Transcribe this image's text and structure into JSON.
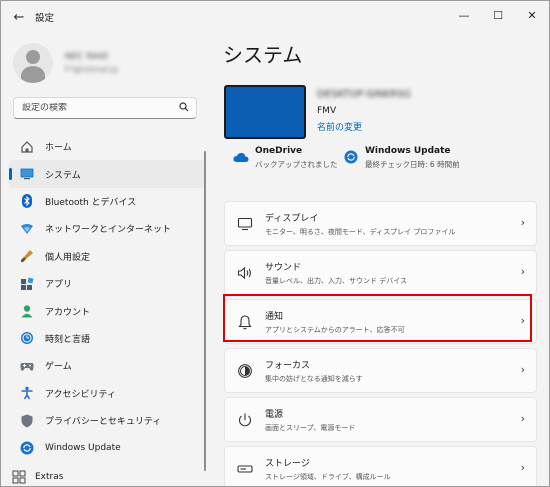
{
  "window": {
    "title": "設定",
    "back_glyph": "←",
    "minimize_glyph": "—",
    "maximize_glyph": "☐",
    "close_glyph": "✕"
  },
  "profile": {
    "name": "NEC RAID",
    "email": "F*@hotmail.jp"
  },
  "search": {
    "placeholder": "設定の検索",
    "icon": "search-icon"
  },
  "nav": {
    "items": [
      {
        "label": "ホーム",
        "icon": "home-icon"
      },
      {
        "label": "システム",
        "icon": "system-icon",
        "active": true
      },
      {
        "label": "Bluetooth とデバイス",
        "icon": "bluetooth-icon"
      },
      {
        "label": "ネットワークとインターネット",
        "icon": "network-icon"
      },
      {
        "label": "個人用設定",
        "icon": "brush-icon"
      },
      {
        "label": "アプリ",
        "icon": "apps-icon"
      },
      {
        "label": "アカウント",
        "icon": "account-icon"
      },
      {
        "label": "時刻と言語",
        "icon": "time-language-icon"
      },
      {
        "label": "ゲーム",
        "icon": "gaming-icon"
      },
      {
        "label": "アクセシビリティ",
        "icon": "accessibility-icon"
      },
      {
        "label": "プライバシーとセキュリティ",
        "icon": "shield-icon"
      },
      {
        "label": "Windows Update",
        "icon": "windows-update-icon"
      }
    ],
    "extras_label": "Extras"
  },
  "main": {
    "title": "システム",
    "device": {
      "name": "DESKTOP-SINKRSG",
      "model": "FMV",
      "rename_link": "名前の変更"
    },
    "onedrive": {
      "title": "OneDrive",
      "subtitle": "バックアップされました"
    },
    "windows_update": {
      "title": "Windows Update",
      "subtitle": "最終チェック日時: 6 時間前"
    },
    "cards": [
      {
        "title": "ディスプレイ",
        "subtitle": "モニター、明るさ、夜間モード、ディスプレイ プロファイル",
        "icon": "display-icon"
      },
      {
        "title": "サウンド",
        "subtitle": "音量レベル、出力、入力、サウンド デバイス",
        "icon": "sound-icon"
      },
      {
        "title": "通知",
        "subtitle": "アプリとシステムからのアラート、応答不可",
        "icon": "bell-icon"
      },
      {
        "title": "フォーカス",
        "subtitle": "集中の妨げとなる通知を減らす",
        "icon": "focus-icon"
      },
      {
        "title": "電源",
        "subtitle": "画面とスリープ、電源モード",
        "icon": "power-icon"
      },
      {
        "title": "ストレージ",
        "subtitle": "ストレージ領域、ドライブ、構成ルール",
        "icon": "storage-icon"
      }
    ]
  },
  "colors": {
    "accent": "#0067c0",
    "highlight": "#e00000",
    "device_thumb": "#0b5eb3"
  }
}
